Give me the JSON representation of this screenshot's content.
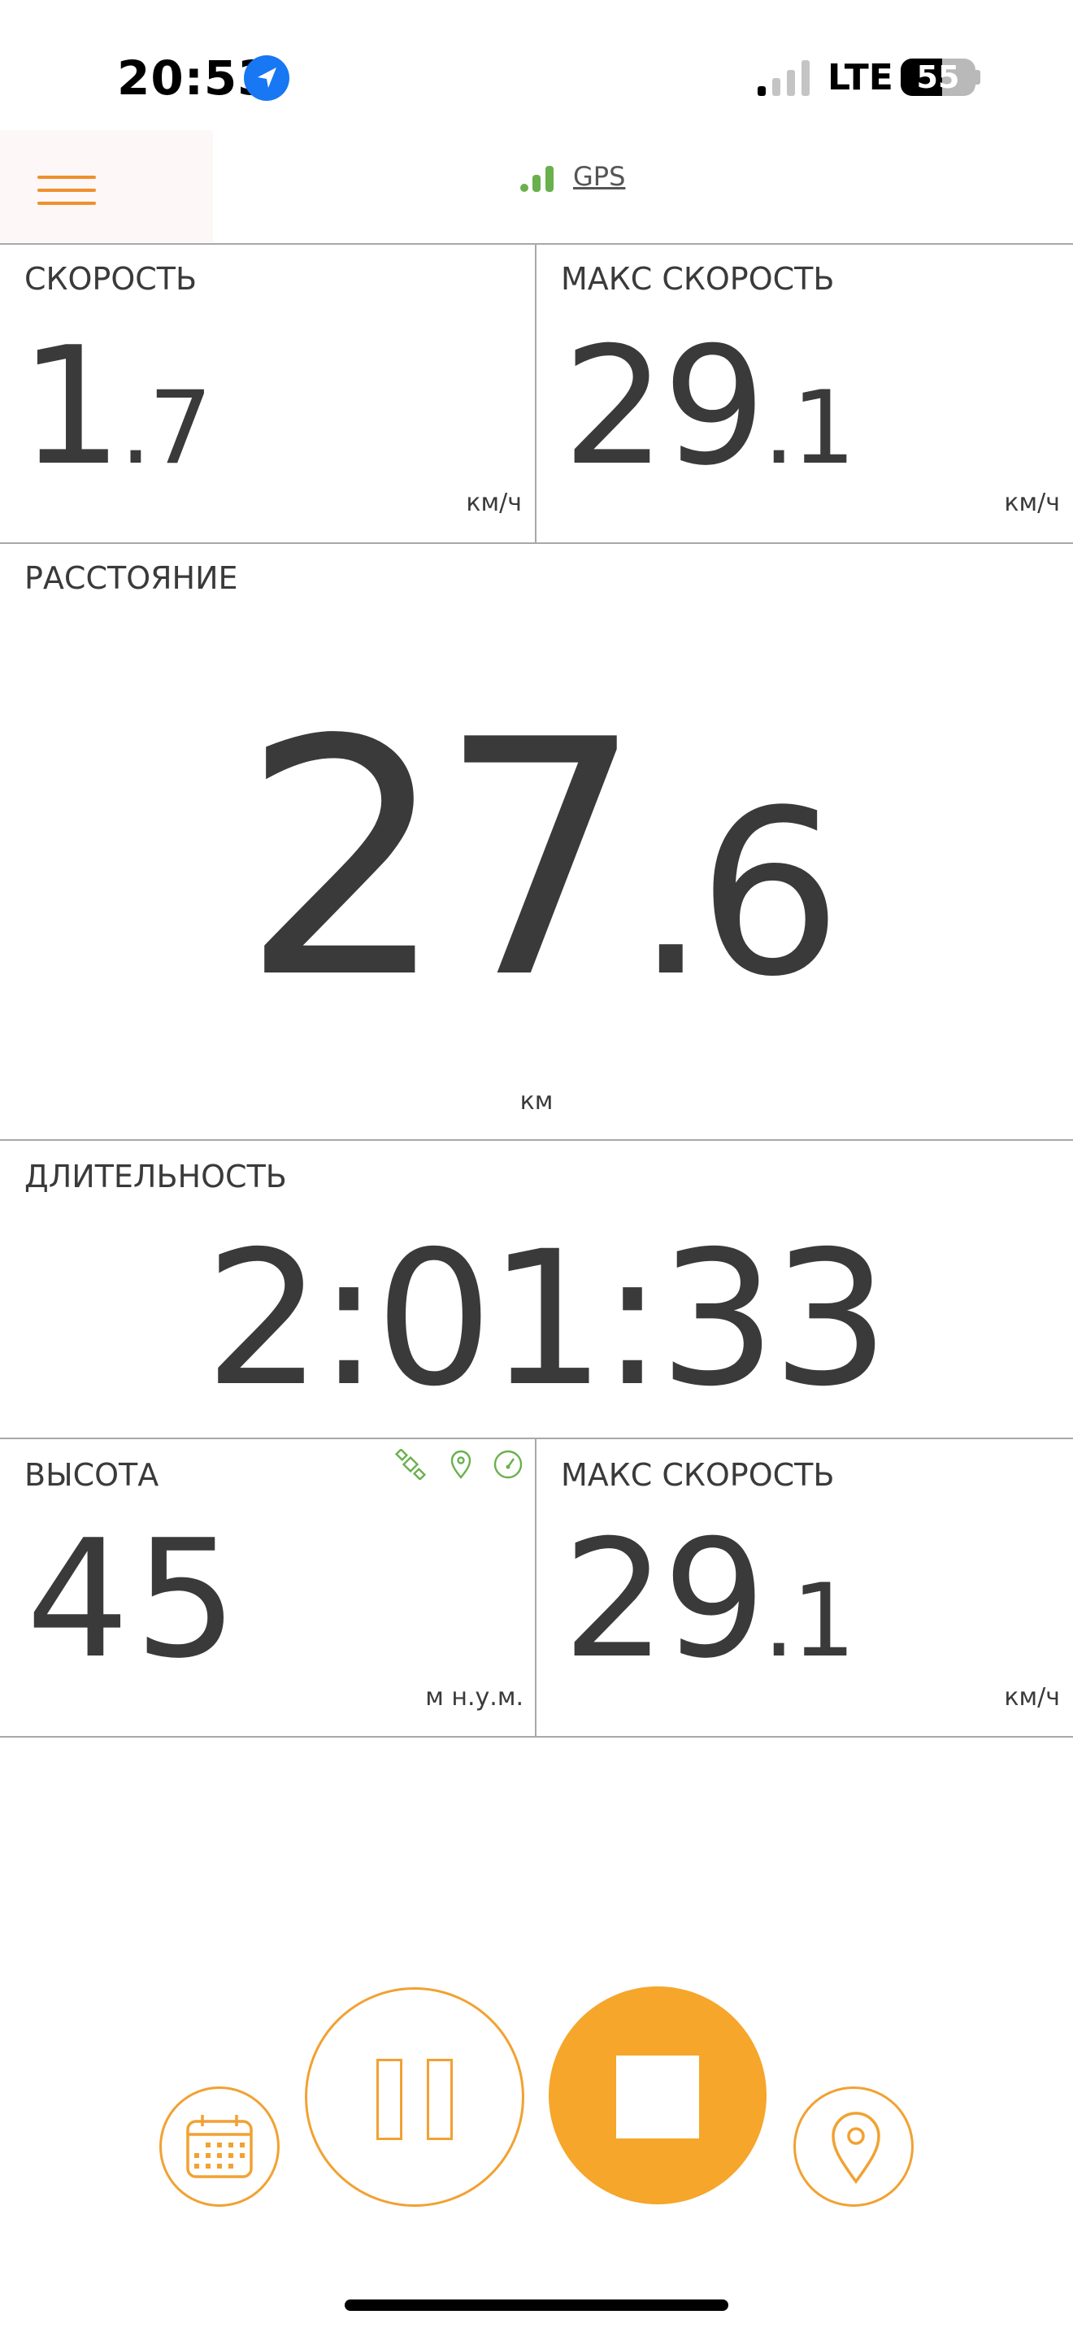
{
  "status_bar": {
    "time": "20:53",
    "network": "LTE",
    "battery": "55",
    "battery_level": 0.55
  },
  "header": {
    "gps_label": "GPS"
  },
  "tiles": {
    "speed": {
      "label": "СКОРОСТЬ",
      "int": "1",
      "dec": ".7",
      "unit": "км/ч"
    },
    "max_speed_top": {
      "label": "МАКС СКОРОСТЬ",
      "int": "29",
      "dec": ".1",
      "unit": "км/ч"
    },
    "distance": {
      "label": "РАССТОЯНИЕ",
      "int": "27",
      "dec": ".6",
      "unit": "км"
    },
    "duration": {
      "label": "ДЛИТЕЛЬНОСТЬ",
      "value": "2:01:33"
    },
    "altitude": {
      "label": "ВЫСОТА",
      "value": "45",
      "unit": "м н.у.м."
    },
    "max_speed_bottom": {
      "label": "МАКС СКОРОСТЬ",
      "int": "29",
      "dec": ".1",
      "unit": "км/ч"
    }
  },
  "colors": {
    "accent": "#f5a62b",
    "gps_green": "#6ab04c",
    "text": "#3a3a3a"
  }
}
